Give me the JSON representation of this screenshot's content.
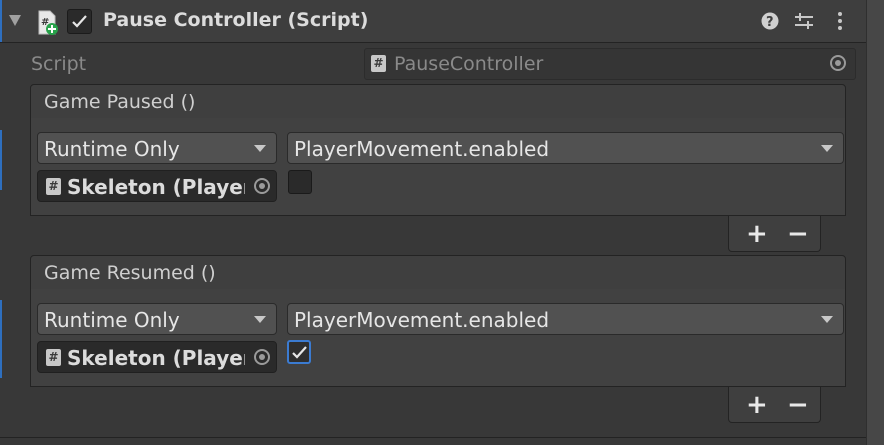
{
  "component": {
    "title": "Pause Controller (Script)",
    "enabled": true,
    "script_label": "Script",
    "script_value": "PauseController"
  },
  "events": [
    {
      "name": "Game Paused ()",
      "listener": {
        "call_state": "Runtime Only",
        "object": "Skeleton (Player Movement)",
        "function": "PlayerMovement.enabled",
        "value": false
      },
      "add_label": "+",
      "remove_label": "−"
    },
    {
      "name": "Game Resumed ()",
      "listener": {
        "call_state": "Runtime Only",
        "object": "Skeleton (Player Movement)",
        "function": "PlayerMovement.enabled",
        "value": true
      },
      "add_label": "+",
      "remove_label": "−"
    }
  ],
  "icons": {
    "foldout": "foldout-arrow-icon",
    "script": "script-icon",
    "help": "help-icon",
    "presets": "presets-icon",
    "menu": "kebab-menu-icon",
    "object_picker": "object-picker-icon"
  },
  "colors": {
    "accent": "#3b7bd1",
    "background": "#383838",
    "panel": "#414141"
  }
}
